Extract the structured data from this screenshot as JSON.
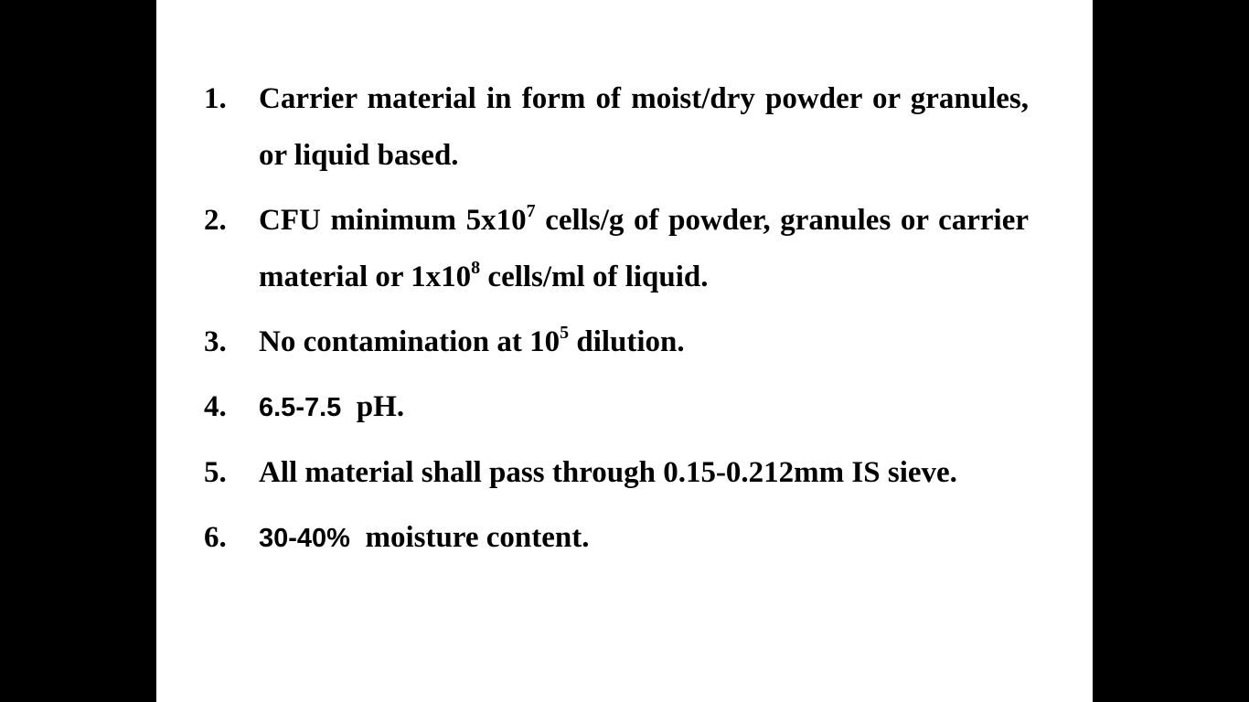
{
  "items": [
    {
      "number": "1.",
      "text": "Carrier material in form of moist/dry powder or granules, or liquid based."
    },
    {
      "number": "2.",
      "part_a": "CFU minimum 5x10",
      "sup_a": "7",
      "part_b": " cells/g of powder, granules or carrier material or 1x10",
      "sup_b": "8",
      "part_c": " cells/ml of liquid."
    },
    {
      "number": "3.",
      "part_a": "No contamination at 10",
      "sup_a": "5",
      "part_b": " dilution."
    },
    {
      "number": "4.",
      "value": "6.5-7.5",
      "unit": "pH."
    },
    {
      "number": "5.",
      "text": "All material shall pass through 0.15-0.212mm IS sieve."
    },
    {
      "number": "6.",
      "value": "30-40%",
      "unit": "moisture content."
    }
  ]
}
